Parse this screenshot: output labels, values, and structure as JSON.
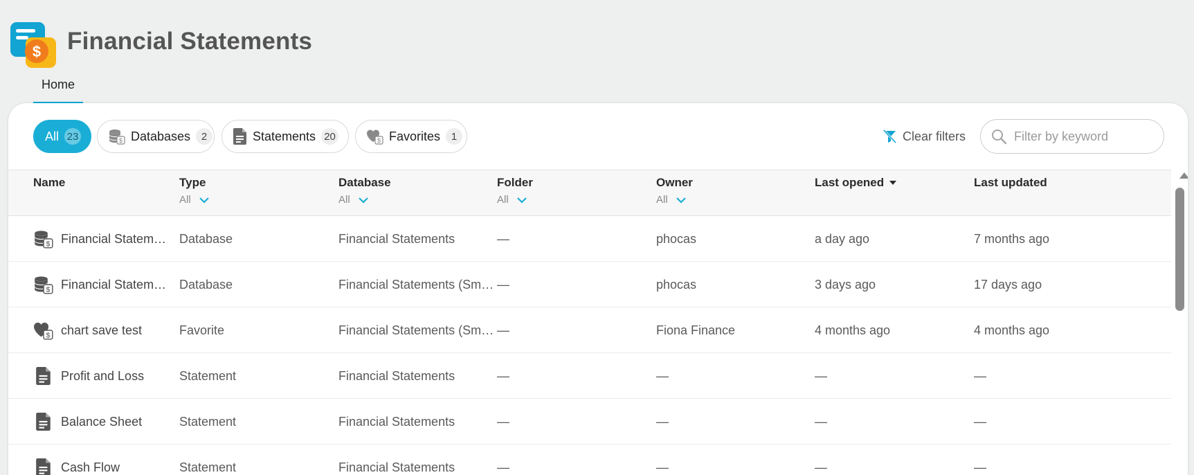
{
  "app": {
    "title": "Financial Statements"
  },
  "nav": {
    "home_tab": "Home"
  },
  "filters": {
    "chips": [
      {
        "label": "All",
        "count": "23"
      },
      {
        "label": "Databases",
        "count": "2"
      },
      {
        "label": "Statements",
        "count": "20"
      },
      {
        "label": "Favorites",
        "count": "1"
      }
    ],
    "clear_label": "Clear filters",
    "search_placeholder": "Filter by keyword"
  },
  "table": {
    "columns": {
      "name": "Name",
      "type": "Type",
      "type_filter": "All",
      "database": "Database",
      "database_filter": "All",
      "folder": "Folder",
      "folder_filter": "All",
      "owner": "Owner",
      "owner_filter": "All",
      "last_opened": "Last opened",
      "last_updated": "Last updated"
    },
    "rows": [
      {
        "icon": "database-dollar-icon",
        "name": "Financial Statem…",
        "type": "Database",
        "database": "Financial Statements",
        "folder": "—",
        "owner": "phocas",
        "last_opened": "a day ago",
        "last_updated": "7 months ago"
      },
      {
        "icon": "database-dollar-icon",
        "name": "Financial Statem…",
        "type": "Database",
        "database": "Financial Statements (Sm…",
        "folder": "—",
        "owner": "phocas",
        "last_opened": "3 days ago",
        "last_updated": "17 days ago"
      },
      {
        "icon": "heart-dollar-icon",
        "name": "chart save test",
        "type": "Favorite",
        "database": "Financial Statements (Sm…",
        "folder": "—",
        "owner": "Fiona Finance",
        "last_opened": "4 months ago",
        "last_updated": "4 months ago"
      },
      {
        "icon": "document-icon",
        "name": "Profit and Loss",
        "type": "Statement",
        "database": "Financial Statements",
        "folder": "—",
        "owner": "—",
        "last_opened": "—",
        "last_updated": "—"
      },
      {
        "icon": "document-icon",
        "name": "Balance Sheet",
        "type": "Statement",
        "database": "Financial Statements",
        "folder": "—",
        "owner": "—",
        "last_opened": "—",
        "last_updated": "—"
      },
      {
        "icon": "document-icon",
        "name": "Cash Flow",
        "type": "Statement",
        "database": "Financial Statements",
        "folder": "—",
        "owner": "—",
        "last_opened": "—",
        "last_updated": "—"
      }
    ]
  },
  "colors": {
    "accent": "#1aaed6",
    "logo_blue": "#12a4d2",
    "logo_orange": "#f07c1c",
    "logo_yellow": "#f7b718"
  }
}
